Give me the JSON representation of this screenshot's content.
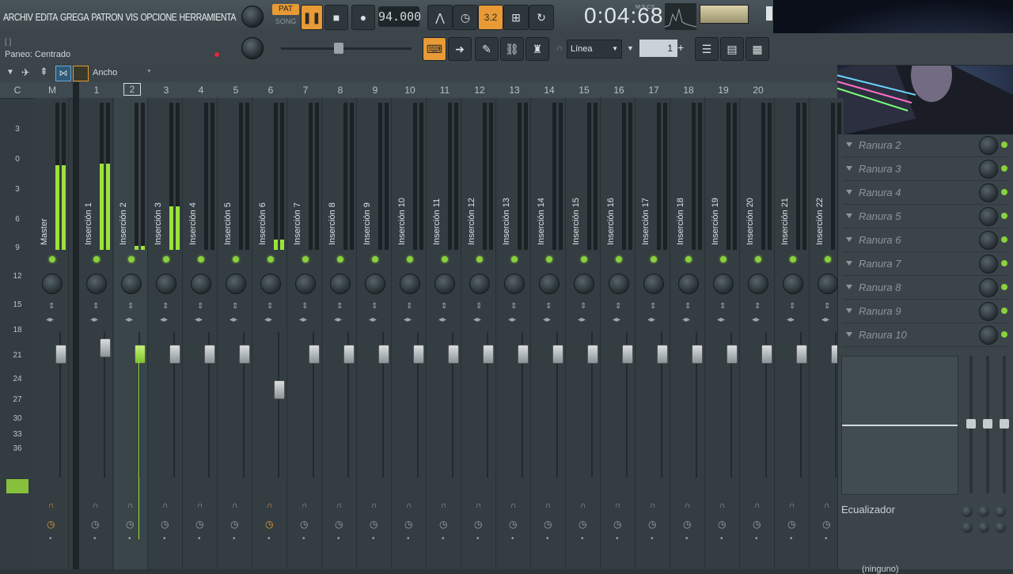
{
  "menu": [
    "ARCHIV",
    "EDITA",
    "GREGA",
    "PATRON",
    "VIS",
    "OPCIONE",
    "HERRAMIENTA"
  ],
  "transport": {
    "pat_label": "PAT",
    "song_label": "SONG",
    "tempo": "94.000",
    "time": "0:04:68",
    "time_unit": "M:S:CS",
    "snap": "3.2"
  },
  "hint": {
    "line1": "[  ]",
    "line2": "Paneo: Centrado"
  },
  "toolbar2": {
    "mode_select": "Línea",
    "step_value": "1"
  },
  "mixer_header": {
    "width_label": "Ancho"
  },
  "channel_numbers": [
    "C",
    "M",
    "1",
    "2",
    "3",
    "4",
    "5",
    "6",
    "7",
    "8",
    "9",
    "10",
    "11",
    "12",
    "13",
    "14",
    "15",
    "16",
    "17",
    "18",
    "19",
    "20"
  ],
  "tracks": [
    {
      "name": "Master",
      "level": 0.82,
      "fader": 0.0
    },
    {
      "name": "Inserción 1",
      "level": 0.84,
      "fader": 0.05
    },
    {
      "name": "Inserción 2",
      "level": 0.04,
      "fader": 0.0
    },
    {
      "name": "Inserción 3",
      "level": 0.42,
      "fader": 0.0
    },
    {
      "name": "Inserción 4",
      "level": 0.0,
      "fader": 0.0
    },
    {
      "name": "Inserción 5",
      "level": 0.0,
      "fader": 0.0
    },
    {
      "name": "Inserción 6",
      "level": 0.1,
      "fader": -0.28
    },
    {
      "name": "Inserción 7",
      "level": 0.0,
      "fader": 0.0
    },
    {
      "name": "Inserción 8",
      "level": 0.0,
      "fader": 0.0
    },
    {
      "name": "Inserción 9",
      "level": 0.0,
      "fader": 0.0
    },
    {
      "name": "Inserción 10",
      "level": 0.0,
      "fader": 0.0
    },
    {
      "name": "Inserción 11",
      "level": 0.0,
      "fader": 0.0
    },
    {
      "name": "Inserción 12",
      "level": 0.0,
      "fader": 0.0
    },
    {
      "name": "Inserción 13",
      "level": 0.0,
      "fader": 0.0
    },
    {
      "name": "Inserción 14",
      "level": 0.0,
      "fader": 0.0
    },
    {
      "name": "Inserción 15",
      "level": 0.0,
      "fader": 0.0
    },
    {
      "name": "Inserción 16",
      "level": 0.0,
      "fader": 0.0
    },
    {
      "name": "Inserción 17",
      "level": 0.0,
      "fader": 0.0
    },
    {
      "name": "Inserción 18",
      "level": 0.0,
      "fader": 0.0
    },
    {
      "name": "Inserción 19",
      "level": 0.0,
      "fader": 0.0
    },
    {
      "name": "Inserción 20",
      "level": 0.0,
      "fader": 0.0
    },
    {
      "name": "Inserción 21",
      "level": 0.0,
      "fader": 0.0
    },
    {
      "name": "Inserción 22",
      "level": 0.0,
      "fader": 0.0
    }
  ],
  "db_scale": [
    "3",
    "0",
    "3",
    "6",
    "9",
    "12",
    "15",
    "18",
    "21",
    "24",
    "27",
    "30",
    "33",
    "36"
  ],
  "slots": [
    "Ranura 2",
    "Ranura 3",
    "Ranura 4",
    "Ranura 5",
    "Ranura 6",
    "Ranura 7",
    "Ranura 8",
    "Ranura 9",
    "Ranura 10"
  ],
  "eq_label": "Ecualizador",
  "bottom_text": "(ninguno)",
  "colors": {
    "accent": "#e79a35",
    "meter": "#9ce23a",
    "led": "#8bd03c"
  }
}
